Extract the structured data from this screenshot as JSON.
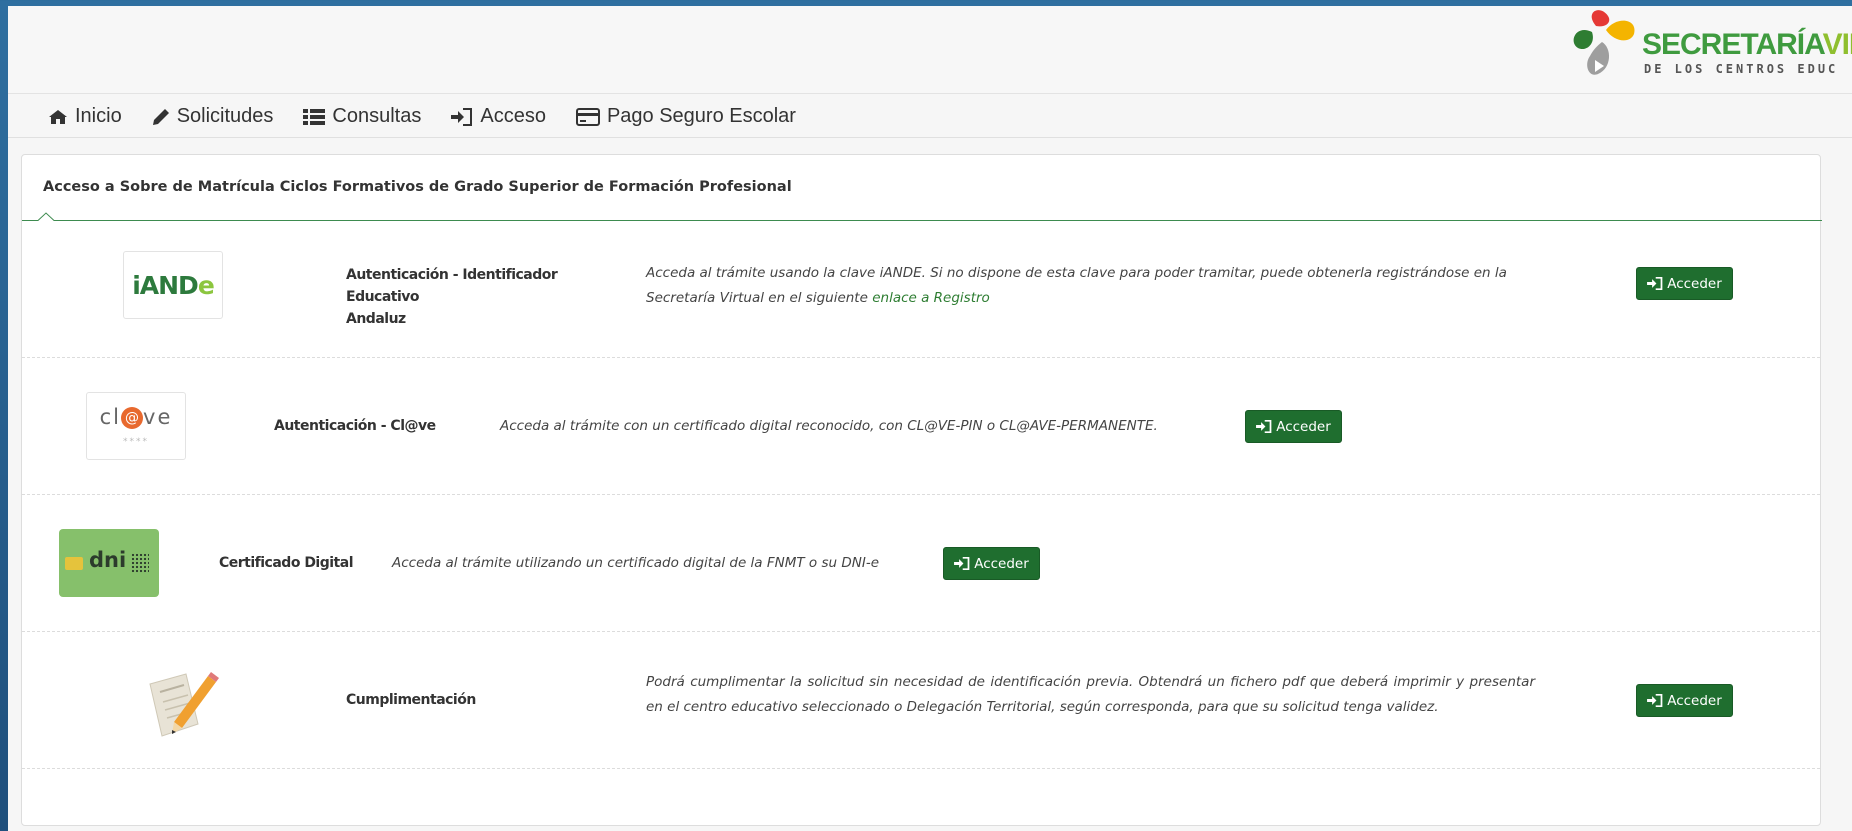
{
  "brand": {
    "title_part1": "SECRETARÍA",
    "title_part2": "VIR",
    "subtitle": "DE LOS CENTROS EDUC"
  },
  "nav": [
    {
      "label": "Inicio",
      "icon": "home-icon"
    },
    {
      "label": "Solicitudes",
      "icon": "pencil-icon"
    },
    {
      "label": "Consultas",
      "icon": "list-icon"
    },
    {
      "label": "Acceso",
      "icon": "sign-in-icon"
    },
    {
      "label": "Pago Seguro Escolar",
      "icon": "credit-card-icon"
    }
  ],
  "panel": {
    "title": "Acceso a Sobre de Matrícula Ciclos Formativos de Grado Superior de Formación Profesional"
  },
  "methods": [
    {
      "title_line1": "Autenticación - Identificador Educativo",
      "title_line2": "Andaluz",
      "description": "Acceda al trámite usando la clave iANDE. Si no dispone de esta clave para poder tramitar, puede obtenerla registrándose en la Secretaría Virtual en el siguiente",
      "link_text": "enlace a Registro",
      "button_label": "Acceder",
      "logo_text": "iAND",
      "logo_text_accent": "e"
    },
    {
      "title": "Autenticación - Cl@ve",
      "description": "Acceda al trámite con un certificado digital reconocido, con CL@VE-PIN o CL@AVE-PERMANENTE.",
      "button_label": "Acceder",
      "logo_text_left": "cl",
      "logo_text_at": "@",
      "logo_text_right": "ve",
      "logo_stars": "****"
    },
    {
      "title": "Certificado Digital",
      "description": "Acceda al trámite utilizando un certificado digital de la FNMT o su DNI-e",
      "button_label": "Acceder",
      "logo_text": "dni"
    },
    {
      "title": "Cumplimentación",
      "description": "Podrá cumplimentar la solicitud sin necesidad de identificación previa. Obtendrá un fichero pdf que deberá imprimir y presentar en el centro educativo seleccionado o Delegación Territorial, según corresponda, para que su solicitud tenga validez.",
      "button_label": "Acceder"
    }
  ],
  "colors": {
    "button_bg": "#1f6e2f",
    "link": "#2e7d32",
    "brand_green": "#3f9b3f",
    "brand_lime": "#8fbf2f"
  }
}
